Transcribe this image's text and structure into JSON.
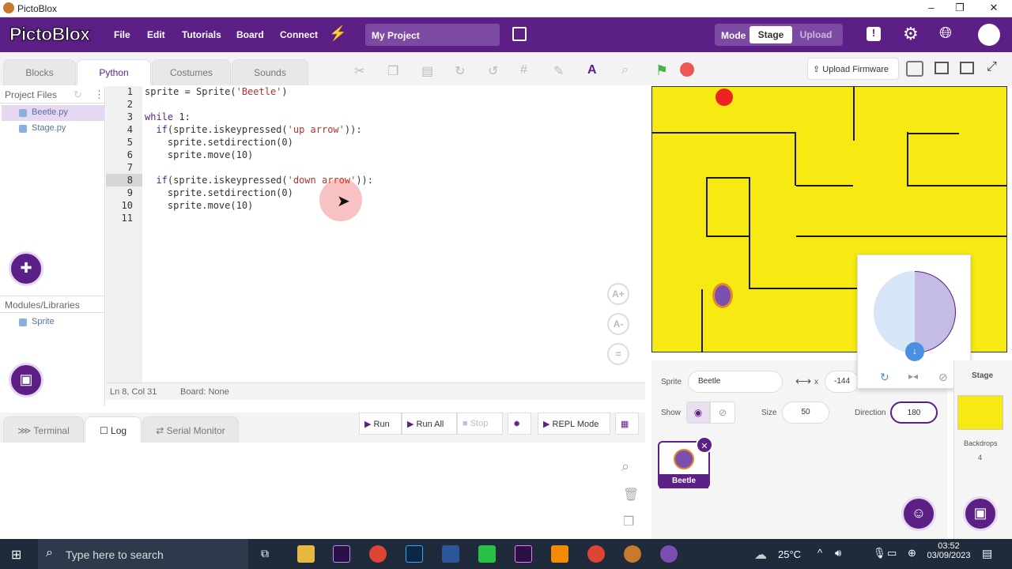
{
  "window": {
    "title": "PictoBlox",
    "min": "–",
    "max": "❐",
    "close": "✕"
  },
  "menubar": {
    "logo": "PictoBlox",
    "items": [
      "File",
      "Edit",
      "Tutorials",
      "Board",
      "Connect"
    ],
    "project_name": "My Project",
    "mode_label": "Mode",
    "mode_stage": "Stage",
    "mode_upload": "Upload"
  },
  "tabs": {
    "blocks": "Blocks",
    "python": "Python",
    "costumes": "Costumes",
    "sounds": "Sounds"
  },
  "toolbar": {
    "upload_firmware": "Upload Firmware"
  },
  "files": {
    "header": "Project Files",
    "items": [
      "Beetle.py",
      "Stage.py"
    ],
    "modules_header": "Modules/Libraries",
    "modules": [
      "Sprite"
    ]
  },
  "code": {
    "lines": [
      {
        "n": "1",
        "t": "sprite = Sprite('Beetle')"
      },
      {
        "n": "2",
        "t": ""
      },
      {
        "n": "3",
        "t": "while 1:"
      },
      {
        "n": "4",
        "t": "  if(sprite.iskeypressed('up arrow')):"
      },
      {
        "n": "5",
        "t": "    sprite.setdirection(0)"
      },
      {
        "n": "6",
        "t": "    sprite.move(10)"
      },
      {
        "n": "7",
        "t": ""
      },
      {
        "n": "8",
        "t": "  if(sprite.iskeypressed('down arrow')):"
      },
      {
        "n": "9",
        "t": "    sprite.setdirection(0)"
      },
      {
        "n": "10",
        "t": "    sprite.move(10)"
      },
      {
        "n": "11",
        "t": ""
      }
    ]
  },
  "status": {
    "position": "Ln 8, Col 31",
    "board": "Board: None"
  },
  "bottom_tabs": {
    "terminal": "Terminal",
    "log": "Log",
    "serial": "Serial Monitor"
  },
  "run_controls": {
    "run": "Run",
    "run_all": "Run All",
    "stop": "Stop",
    "repl": "REPL Mode"
  },
  "sprite_info": {
    "sprite_label": "Sprite",
    "sprite_name": "Beetle",
    "x_label": "x",
    "x_value": "-144",
    "show_label": "Show",
    "size_label": "Size",
    "size_value": "50",
    "direction_label": "Direction",
    "direction_value": "180"
  },
  "sprite_list": {
    "sprite_name": "Beetle"
  },
  "stage_panel": {
    "label": "Stage",
    "backdrops_label": "Backdrops",
    "backdrops_count": "4"
  },
  "taskbar": {
    "search_placeholder": "Type here to search",
    "temperature": "25°C",
    "time": "03:52",
    "date": "03/09/2023"
  },
  "colors": {
    "brand": "#5b1f86",
    "stage": "#f6ea12"
  }
}
